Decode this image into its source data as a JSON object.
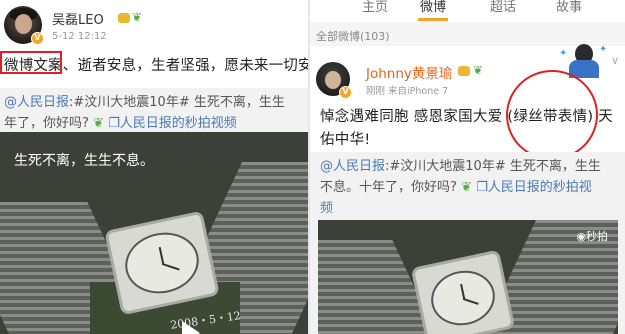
{
  "left_post": {
    "user": {
      "name": "吴磊LEO",
      "time": "5-12 12:12"
    },
    "text": "微博文案、逝者安息，生者坚强，愿未来一切安好",
    "shared": {
      "line1_tag": "@人民日报",
      "line1_rest": ":#汶川大地震10年# 生死不离，生生",
      "line2_start": "年了，你好吗?",
      "line2_link": "人民日报的秒拍视频",
      "video_caption": "生死不离，生生不息。",
      "stone_date": "2008・5・12"
    }
  },
  "right_post": {
    "tabs": [
      {
        "label": "主页"
      },
      {
        "label": "微博"
      },
      {
        "label": "超话"
      },
      {
        "label": "故事"
      }
    ],
    "filter": "全部微博(103)",
    "user": {
      "name": "Johnny黄景瑜",
      "time": "刚刚 来自iPhone 7"
    },
    "text": "悼念遇难同胞 感恩家国大爱 (绿丝带表情) 天佑中华!",
    "shared": {
      "line1_tag": "@人民日报",
      "line1_rest": ":#汶川大地震10年# 生死不离，生生",
      "line2": "不息。十年了，你好吗?",
      "line2_link": "人民日报的秒拍视",
      "line3": "频",
      "miaopai": "秒拍"
    }
  },
  "colors": {
    "annotation_red": "#e02020",
    "weibo_orange": "#f7a12a",
    "link_blue": "#4a79b6",
    "ribbon_green": "#59a845"
  },
  "icons": [
    "verified-v-icon",
    "gold-member-icon",
    "green-ribbon-icon",
    "play-icon",
    "link-icon",
    "chevron-down-icon"
  ]
}
